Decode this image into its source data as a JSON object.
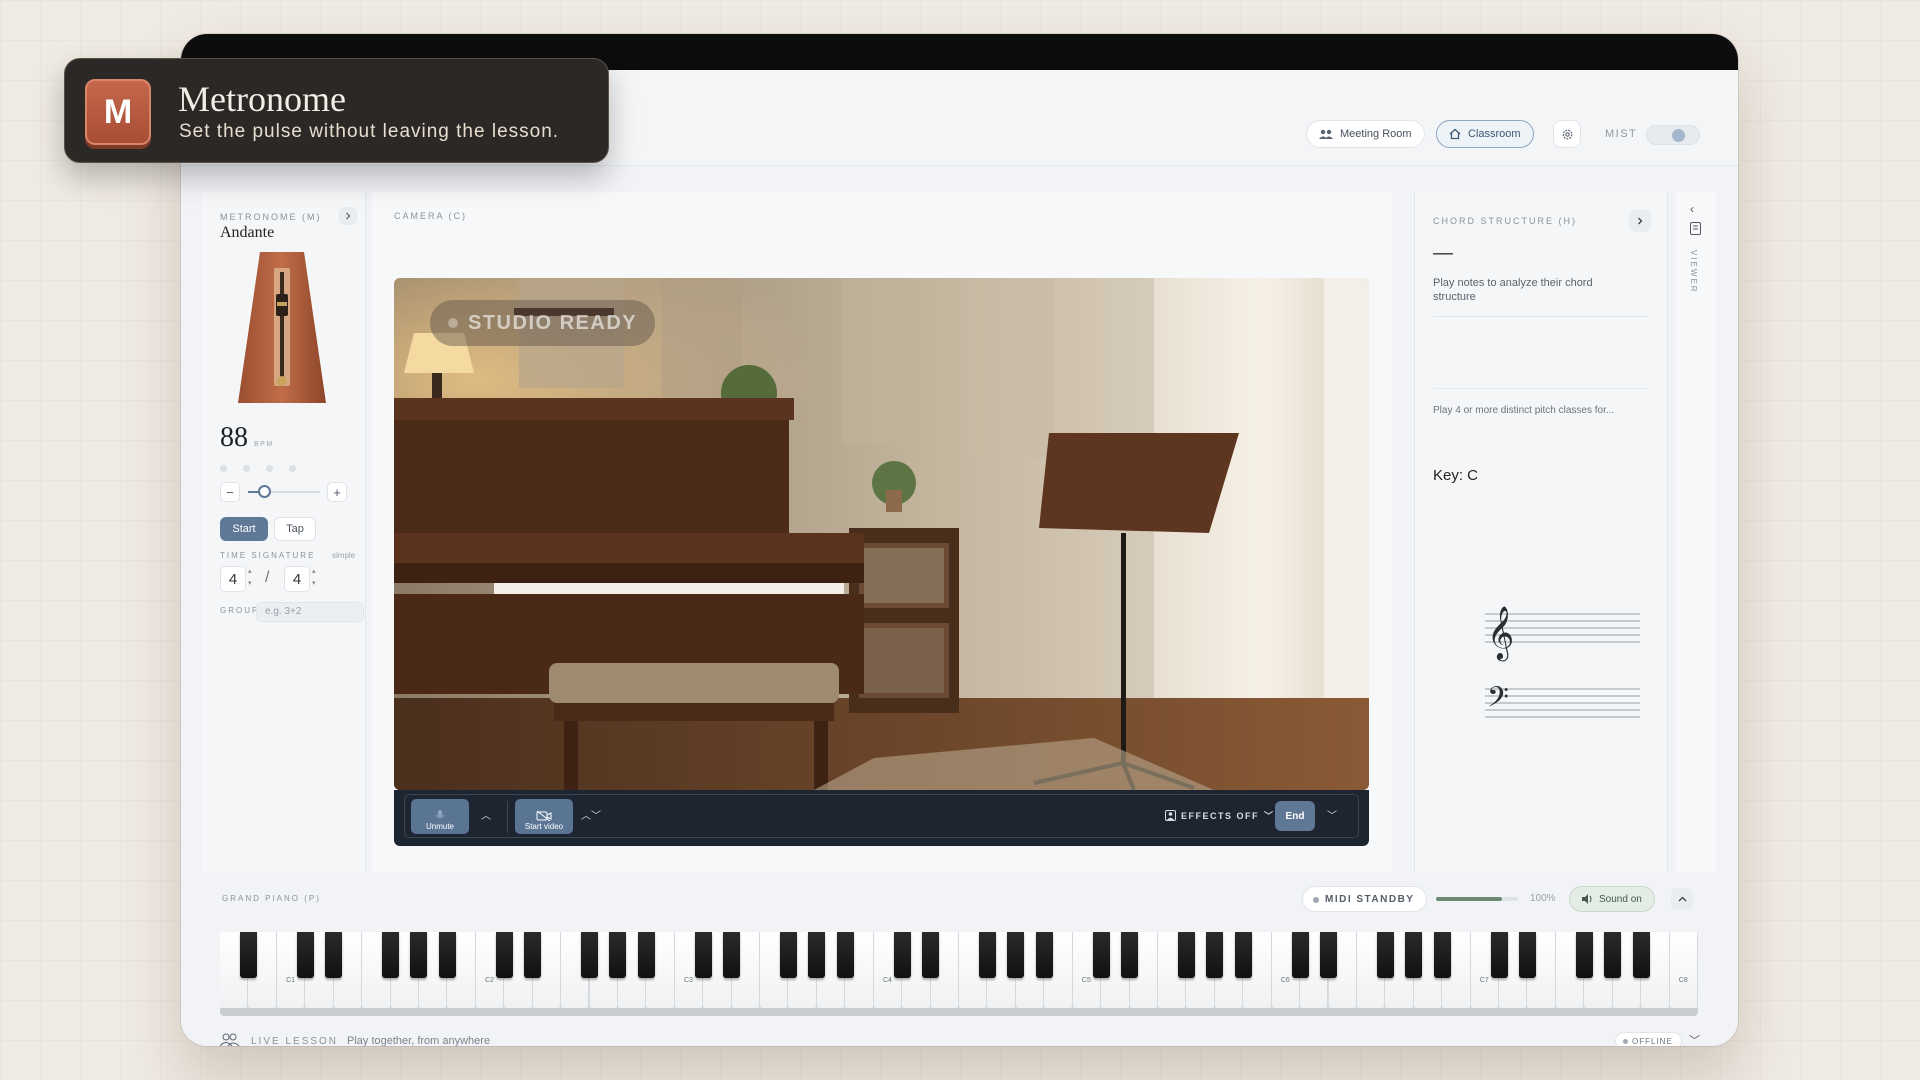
{
  "toast": {
    "icon_letter": "M",
    "title": "Metronome",
    "subtitle": "Set the pulse without leaving the lesson."
  },
  "header": {
    "meeting_room_label": "Meeting Room",
    "classroom_label": "Classroom",
    "mist_label": "MIST"
  },
  "metronome": {
    "section_label": "METRONOME (M)",
    "tempo_name": "Andante",
    "bpm": "88",
    "bpm_unit": "BPM",
    "beat_dots": 4,
    "tempo_slider_position": 0.2,
    "minus_label": "−",
    "plus_label": "+",
    "start_label": "Start",
    "tap_label": "Tap",
    "time_signature_label": "TIME SIGNATURE",
    "time_signature_type": "simple",
    "numerator": "4",
    "denominator": "4",
    "slash": "/",
    "group_label": "GROUP",
    "group_placeholder": "e.g. 3+2"
  },
  "camera": {
    "section_label": "CAMERA (C)",
    "badge_text": "STUDIO READY",
    "unmute_label": "Unmute",
    "start_video_label": "Start video",
    "effects_label": "EFFECTS OFF",
    "end_label": "End"
  },
  "chord": {
    "section_label": "CHORD STRUCTURE (H)",
    "dash": "—",
    "hint": "Play notes to analyze their chord structure",
    "subhint": "Play 4 or more distinct pitch classes for...",
    "key_label": "Key: C"
  },
  "viewer": {
    "label": "VIEWER"
  },
  "piano": {
    "section_label": "GRAND PIANO (P)",
    "midi_label": "MIDI STANDBY",
    "volume_percent": "100%",
    "volume_level": 0.8,
    "sound_label": "Sound on",
    "octave_labels": [
      "C1",
      "C2",
      "C3",
      "C4",
      "C5",
      "C6",
      "C7",
      "C8"
    ]
  },
  "footer": {
    "live_label": "LIVE LESSON",
    "tagline": "Play together, from anywhere",
    "offline_label": "OFFLINE"
  },
  "colors": {
    "accent": "#5f7896",
    "toast_bg": "#2b2825",
    "toast_icon": "#b9573d",
    "sound_on_bg": "#e3ece5"
  }
}
